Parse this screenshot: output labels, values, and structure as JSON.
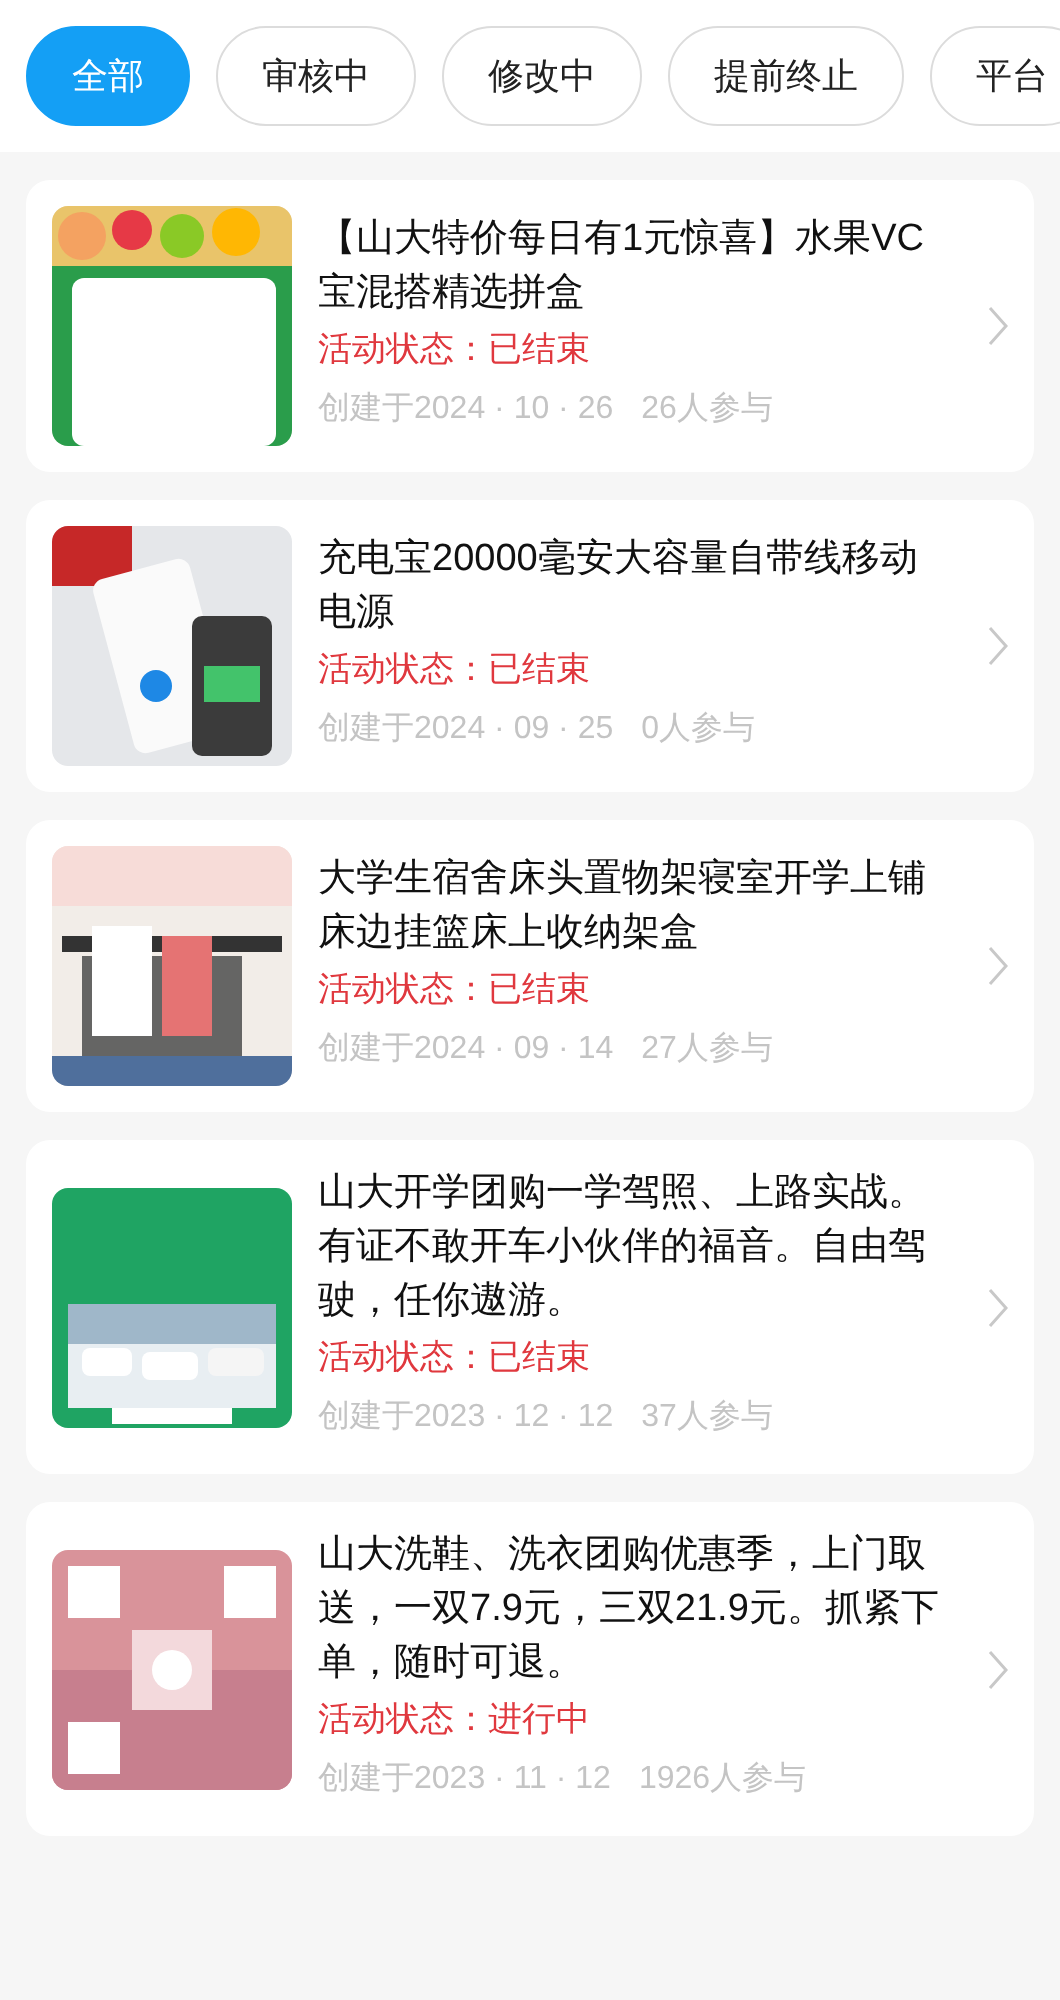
{
  "tabs": [
    {
      "label": "全部",
      "selected": true
    },
    {
      "label": "审核中",
      "selected": false
    },
    {
      "label": "修改中",
      "selected": false
    },
    {
      "label": "提前终止",
      "selected": false
    },
    {
      "label": "平台",
      "selected": false
    }
  ],
  "activities": [
    {
      "title": "【山大特价每日有1元惊喜】水果VC宝混搭精选拼盒",
      "status": "活动状态：已结束",
      "created": "创建于2024 · 10 · 26",
      "participants": "26人参与"
    },
    {
      "title": "充电宝20000毫安大容量自带线移动电源",
      "status": "活动状态：已结束",
      "created": "创建于2024 · 09 · 25",
      "participants": "0人参与"
    },
    {
      "title": "大学生宿舍床头置物架寝室开学上铺床边挂篮床上收纳架盒",
      "status": "活动状态：已结束",
      "created": "创建于2024 · 09 · 14",
      "participants": "27人参与"
    },
    {
      "title": "山大开学团购一学驾照、上路实战。有证不敢开车小伙伴的福音。自由驾驶，任你遨游。",
      "status": "活动状态：已结束",
      "created": "创建于2023 · 12 · 12",
      "participants": "37人参与"
    },
    {
      "title": "山大洗鞋、洗衣团购优惠季，上门取送，一双7.9元，三双21.9元。抓紧下单，随时可退。",
      "status": "活动状态：进行中",
      "created": "创建于2023 · 11 · 12",
      "participants": "1926人参与"
    }
  ]
}
